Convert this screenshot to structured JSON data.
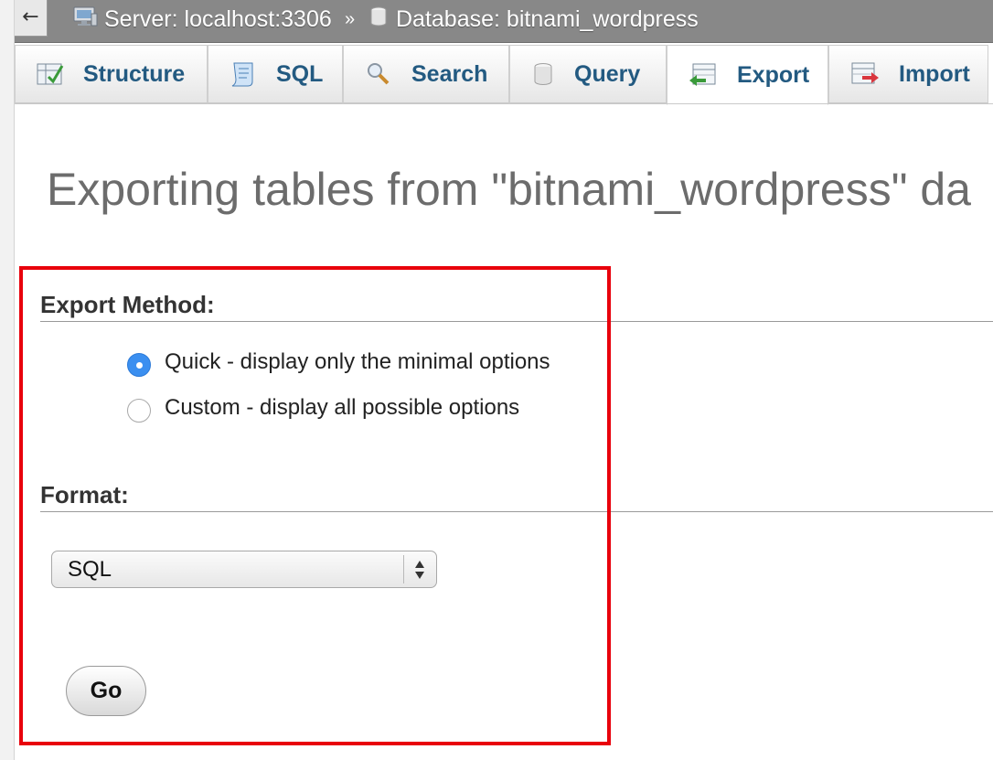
{
  "topbar": {
    "back_glyph": "←",
    "server_label": "Server: localhost:3306",
    "separator": "»",
    "database_label": "Database: bitnami_wordpress",
    "server_icon": "server-icon",
    "database_icon": "database-icon"
  },
  "tabs": [
    {
      "label": "Structure",
      "icon": "structure-icon",
      "active": false
    },
    {
      "label": "SQL",
      "icon": "sql-scroll-icon",
      "active": false
    },
    {
      "label": "Search",
      "icon": "magnifier-icon",
      "active": false
    },
    {
      "label": "Query",
      "icon": "query-cylinder-icon",
      "active": false
    },
    {
      "label": "Export",
      "icon": "export-icon",
      "active": true
    },
    {
      "label": "Import",
      "icon": "import-icon",
      "active": false
    }
  ],
  "page_title": "Exporting tables from \"bitnami_wordpress\" da",
  "export_method": {
    "heading": "Export Method:",
    "options": [
      {
        "label": "Quick - display only the minimal options",
        "checked": true
      },
      {
        "label": "Custom - display all possible options",
        "checked": false
      }
    ]
  },
  "format": {
    "heading": "Format:",
    "selected": "SQL"
  },
  "go_label": "Go",
  "colors": {
    "highlight_border": "#e8000b",
    "tab_text": "#235a81",
    "radio_selected": "#3b8ff0",
    "topbar": "#888888"
  }
}
